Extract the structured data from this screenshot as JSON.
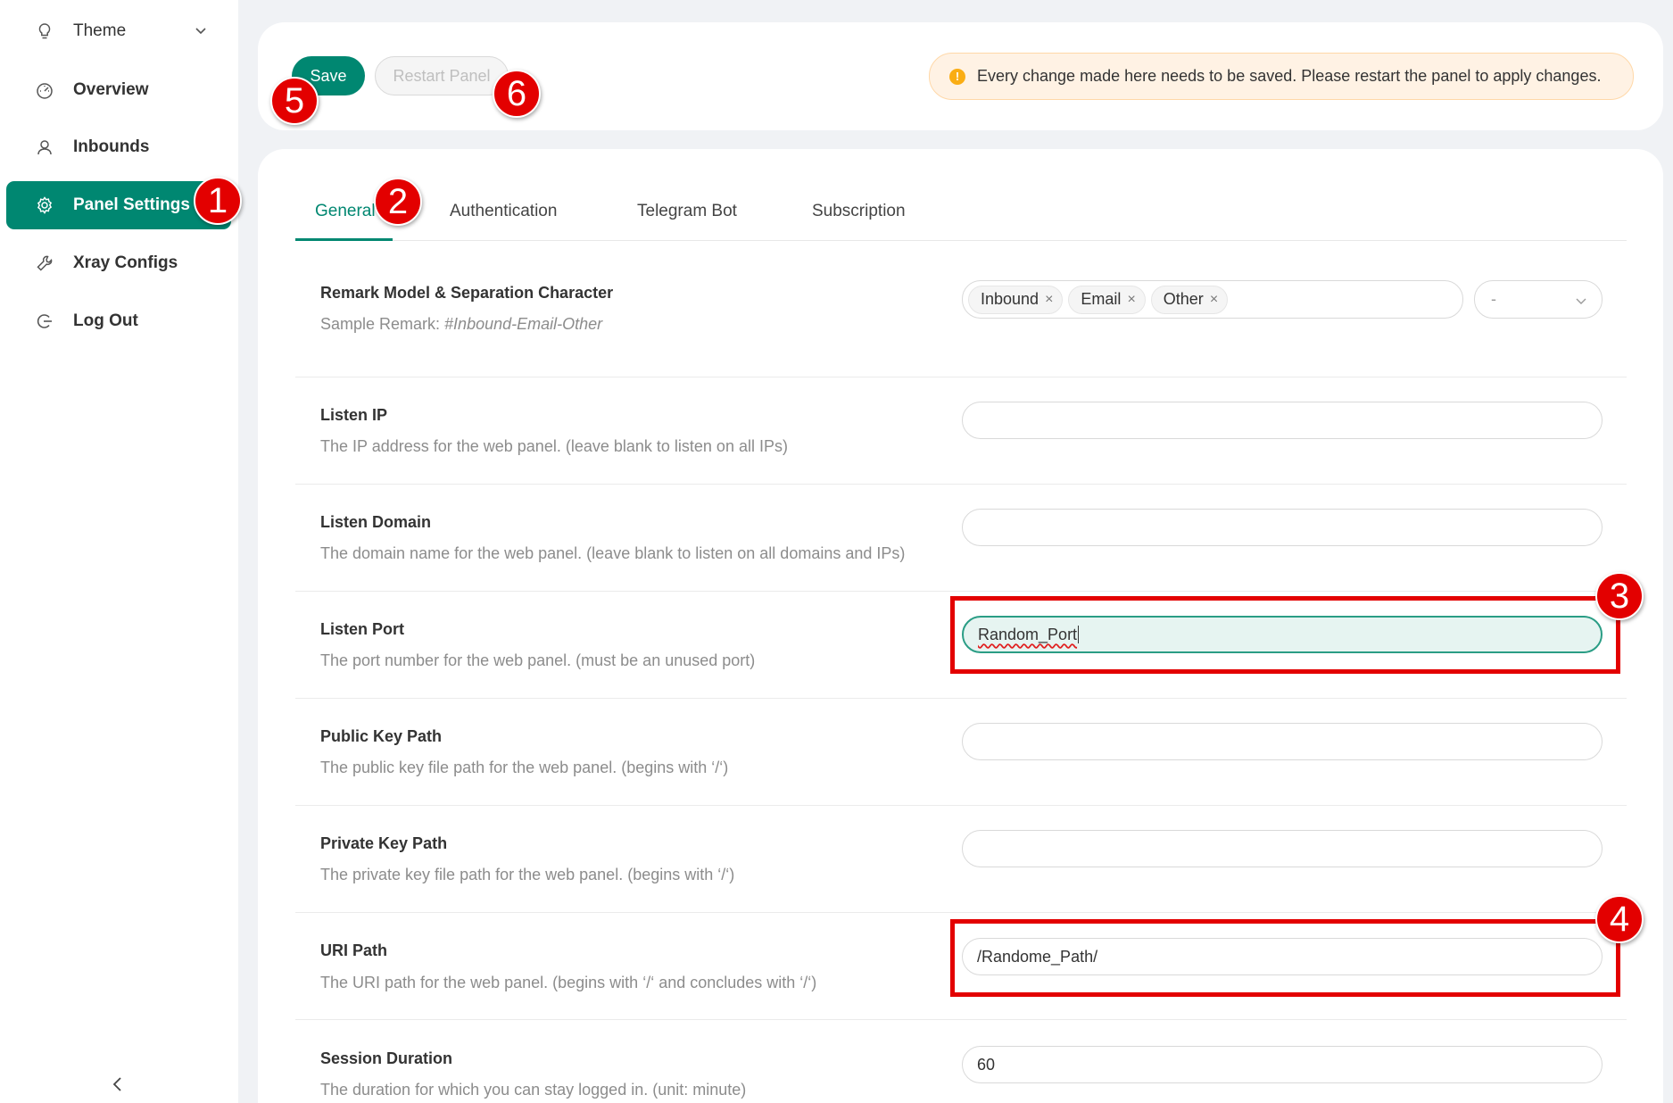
{
  "sidebar": {
    "items": [
      {
        "label": "Theme",
        "icon": "bulb-icon"
      },
      {
        "label": "Overview",
        "icon": "dashboard-icon"
      },
      {
        "label": "Inbounds",
        "icon": "user-icon"
      },
      {
        "label": "Panel Settings",
        "icon": "gear-icon"
      },
      {
        "label": "Xray Configs",
        "icon": "tool-icon"
      },
      {
        "label": "Log Out",
        "icon": "logout-icon"
      }
    ],
    "active_item": "Panel Settings"
  },
  "toolbar": {
    "save_label": "Save",
    "restart_label": "Restart Panel",
    "alert_text": "Every change made here needs to be saved. Please restart the panel to apply changes."
  },
  "tabs": [
    "General",
    "Authentication",
    "Telegram Bot",
    "Subscription"
  ],
  "active_tab": "General",
  "settings": {
    "remark": {
      "title": "Remark Model & Separation Character",
      "desc_prefix": "Sample Remark: ",
      "desc_sample": "#Inbound-Email-Other",
      "tags": [
        "Inbound",
        "Email",
        "Other"
      ],
      "separator": "-"
    },
    "listen_ip": {
      "title": "Listen IP",
      "desc": "The IP address for the web panel. (leave blank to listen on all IPs)",
      "value": ""
    },
    "listen_domain": {
      "title": "Listen Domain",
      "desc": "The domain name for the web panel. (leave blank to listen on all domains and IPs)",
      "value": ""
    },
    "listen_port": {
      "title": "Listen Port",
      "desc": "The port number for the web panel. (must be an unused port)",
      "value": "Random_Port"
    },
    "public_key": {
      "title": "Public Key Path",
      "desc": "The public key file path for the web panel. (begins with ‘/‘)",
      "value": ""
    },
    "private_key": {
      "title": "Private Key Path",
      "desc": "The private key file path for the web panel. (begins with ‘/‘)",
      "value": ""
    },
    "uri_path": {
      "title": "URI Path",
      "desc": "The URI path for the web panel. (begins with ‘/‘ and concludes with ‘/‘)",
      "value": "/Randome_Path/"
    },
    "session_duration": {
      "title": "Session Duration",
      "desc": "The duration for which you can stay logged in. (unit: minute)",
      "value": "60"
    }
  },
  "annotations": [
    "1",
    "2",
    "3",
    "4",
    "5",
    "6"
  ],
  "colors": {
    "accent": "#008771",
    "annotation": "#e30000",
    "alert_bg": "#fff2e4"
  }
}
